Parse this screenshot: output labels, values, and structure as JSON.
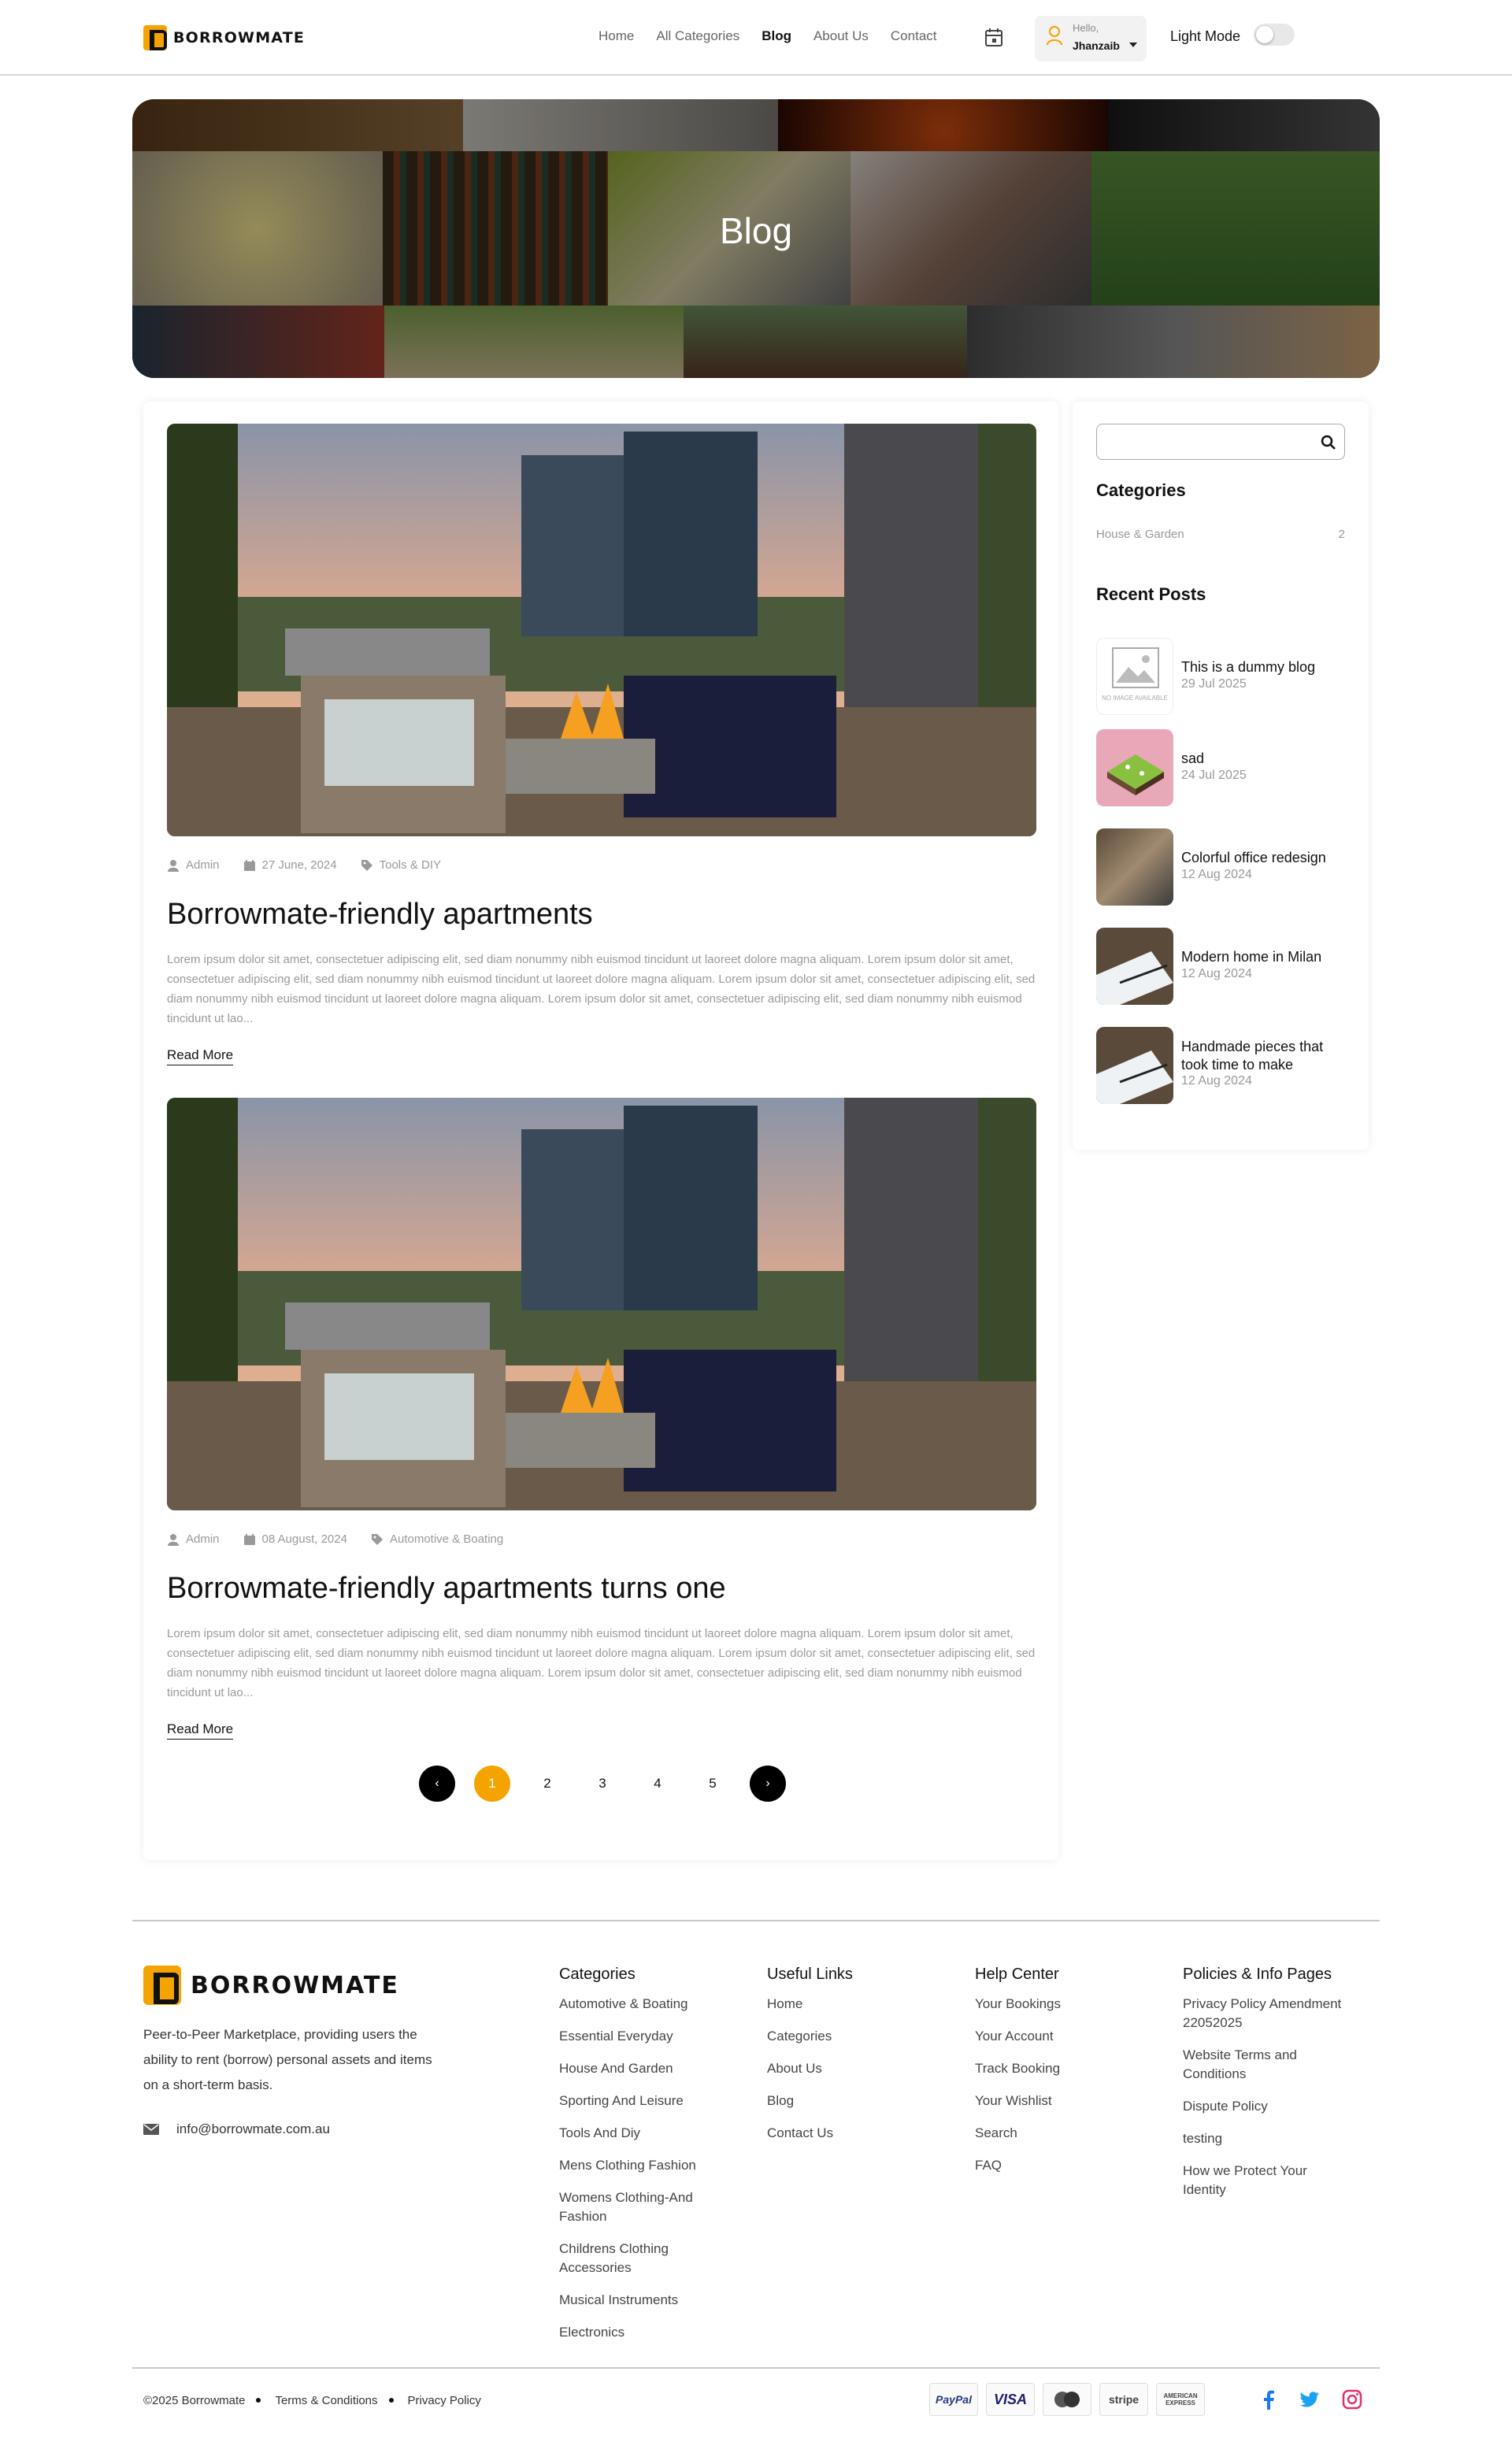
{
  "brand": {
    "name": "BORROWMATE",
    "accent": "#f5a300"
  },
  "nav": {
    "items": [
      {
        "label": "Home",
        "active": false
      },
      {
        "label": "All Categories",
        "active": false
      },
      {
        "label": "Blog",
        "active": true
      },
      {
        "label": "About Us",
        "active": false
      },
      {
        "label": "Contact",
        "active": false
      }
    ]
  },
  "user": {
    "hello": "Hello,",
    "name": "Jhanzaib"
  },
  "mode": {
    "label": "Light Mode",
    "enabled": false
  },
  "hero": {
    "title": "Blog"
  },
  "posts": [
    {
      "author": "Admin",
      "date": "27 June, 2024",
      "category": "Tools & DIY",
      "title": "Borrowmate-friendly apartments",
      "excerpt": "Lorem ipsum dolor sit amet, consectetuer adipiscing elit, sed diam nonummy nibh euismod tincidunt ut laoreet dolore magna aliquam. Lorem ipsum dolor sit amet, consectetuer adipiscing elit, sed diam nonummy nibh euismod tincidunt ut laoreet dolore magna aliquam. Lorem ipsum dolor sit amet, consectetuer adipiscing elit, sed diam nonummy nibh euismod tincidunt ut laoreet dolore magna aliquam. Lorem ipsum dolor sit amet, consectetuer adipiscing elit, sed diam nonummy nibh euismod tincidunt ut lao...",
      "read_more": "Read More"
    },
    {
      "author": "Admin",
      "date": "08 August, 2024",
      "category": "Automotive & Boating",
      "title": "Borrowmate-friendly apartments turns one",
      "excerpt": "Lorem ipsum dolor sit amet, consectetuer adipiscing elit, sed diam nonummy nibh euismod tincidunt ut laoreet dolore magna aliquam. Lorem ipsum dolor sit amet, consectetuer adipiscing elit, sed diam nonummy nibh euismod tincidunt ut laoreet dolore magna aliquam. Lorem ipsum dolor sit amet, consectetuer adipiscing elit, sed diam nonummy nibh euismod tincidunt ut laoreet dolore magna aliquam. Lorem ipsum dolor sit amet, consectetuer adipiscing elit, sed diam nonummy nibh euismod tincidunt ut lao...",
      "read_more": "Read More"
    }
  ],
  "pagination": {
    "prev": "‹",
    "next": "›",
    "pages": [
      "1",
      "2",
      "3",
      "4",
      "5"
    ],
    "current": "1"
  },
  "sidebar": {
    "search_placeholder": "",
    "categories_heading": "Categories",
    "categories": [
      {
        "name": "House & Garden",
        "count": "2"
      }
    ],
    "recent_heading": "Recent Posts",
    "no_image_text": "NO IMAGE AVAILABLE",
    "recent": [
      {
        "title": "This is a dummy blog",
        "date": "29 Jul 2025"
      },
      {
        "title": "sad",
        "date": "24 Jul 2025"
      },
      {
        "title": "Colorful office redesign",
        "date": "12 Aug 2024"
      },
      {
        "title": "Modern home in Milan",
        "date": "12 Aug 2024"
      },
      {
        "title": "Handmade pieces that took time to make",
        "date": "12 Aug 2024"
      }
    ]
  },
  "footer": {
    "about": "Peer-to-Peer Marketplace, providing users the ability to rent (borrow) personal assets and items on a short-term basis.",
    "email": "info@borrowmate.com.au",
    "columns": [
      {
        "heading": "Categories",
        "links": [
          "Automotive & Boating",
          "Essential Everyday",
          "House And Garden",
          "Sporting And Leisure",
          "Tools And Diy",
          "Mens Clothing Fashion",
          "Womens Clothing-And Fashion",
          "Childrens Clothing Accessories",
          "Musical Instruments",
          "Electronics"
        ]
      },
      {
        "heading": "Useful Links",
        "links": [
          "Home",
          "Categories",
          "About Us",
          "Blog",
          "Contact Us"
        ]
      },
      {
        "heading": "Help Center",
        "links": [
          "Your Bookings",
          "Your Account",
          "Track Booking",
          "Your Wishlist",
          "Search",
          "FAQ"
        ]
      },
      {
        "heading": "Policies & Info Pages",
        "links": [
          "Privacy Policy Amendment 22052025",
          "Website Terms and Conditions",
          "Dispute Policy",
          "testing",
          "How we Protect Your Identity"
        ]
      }
    ],
    "copyright": "©2025 Borrowmate",
    "terms": "Terms & Conditions",
    "privacy": "Privacy Policy",
    "payments": [
      "PayPal",
      "VISA",
      "mastercard-icon",
      "stripe",
      "AMERICAN EXPRESS"
    ],
    "social": [
      "facebook-icon",
      "twitter-icon",
      "instagram-icon"
    ],
    "social_colors": {
      "facebook": "#1877f2",
      "twitter": "#1da1f2",
      "instagram": "#e1306c"
    }
  }
}
